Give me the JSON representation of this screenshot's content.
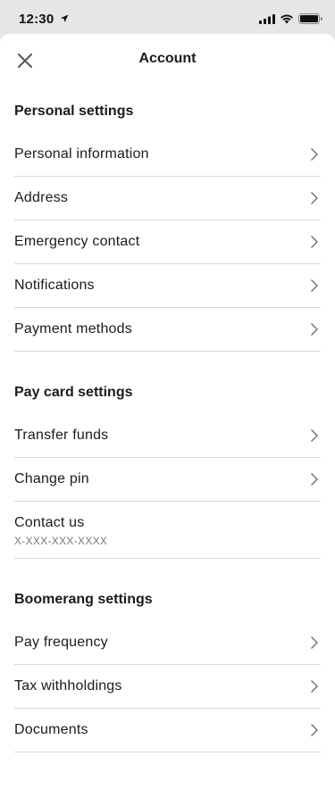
{
  "status_bar": {
    "time": "12:30",
    "location_icon": "location-arrow-icon",
    "signal_icon": "cellular-signal-icon",
    "wifi_icon": "wifi-icon",
    "battery_icon": "battery-icon"
  },
  "header": {
    "title": "Account",
    "close_icon": "close-icon"
  },
  "sections": {
    "personal": {
      "title": "Personal settings",
      "items": [
        {
          "label": "Personal information"
        },
        {
          "label": "Address"
        },
        {
          "label": "Emergency contact"
        },
        {
          "label": "Notifications"
        },
        {
          "label": "Payment methods"
        }
      ]
    },
    "paycard": {
      "title": "Pay card settings",
      "items": [
        {
          "label": "Transfer funds"
        },
        {
          "label": "Change pin"
        },
        {
          "label": "Contact us",
          "sublabel": "X-XXX-XXX-XXXX"
        }
      ]
    },
    "boomerang": {
      "title": "Boomerang settings",
      "items": [
        {
          "label": "Pay frequency"
        },
        {
          "label": "Tax withholdings"
        },
        {
          "label": "Documents"
        }
      ]
    }
  },
  "colors": {
    "background": "#e6e6e6",
    "sheet": "#ffffff",
    "text": "#1b1b1b",
    "divider": "#d9d9d9",
    "chevron": "#6e6e6e",
    "muted": "#777777"
  }
}
